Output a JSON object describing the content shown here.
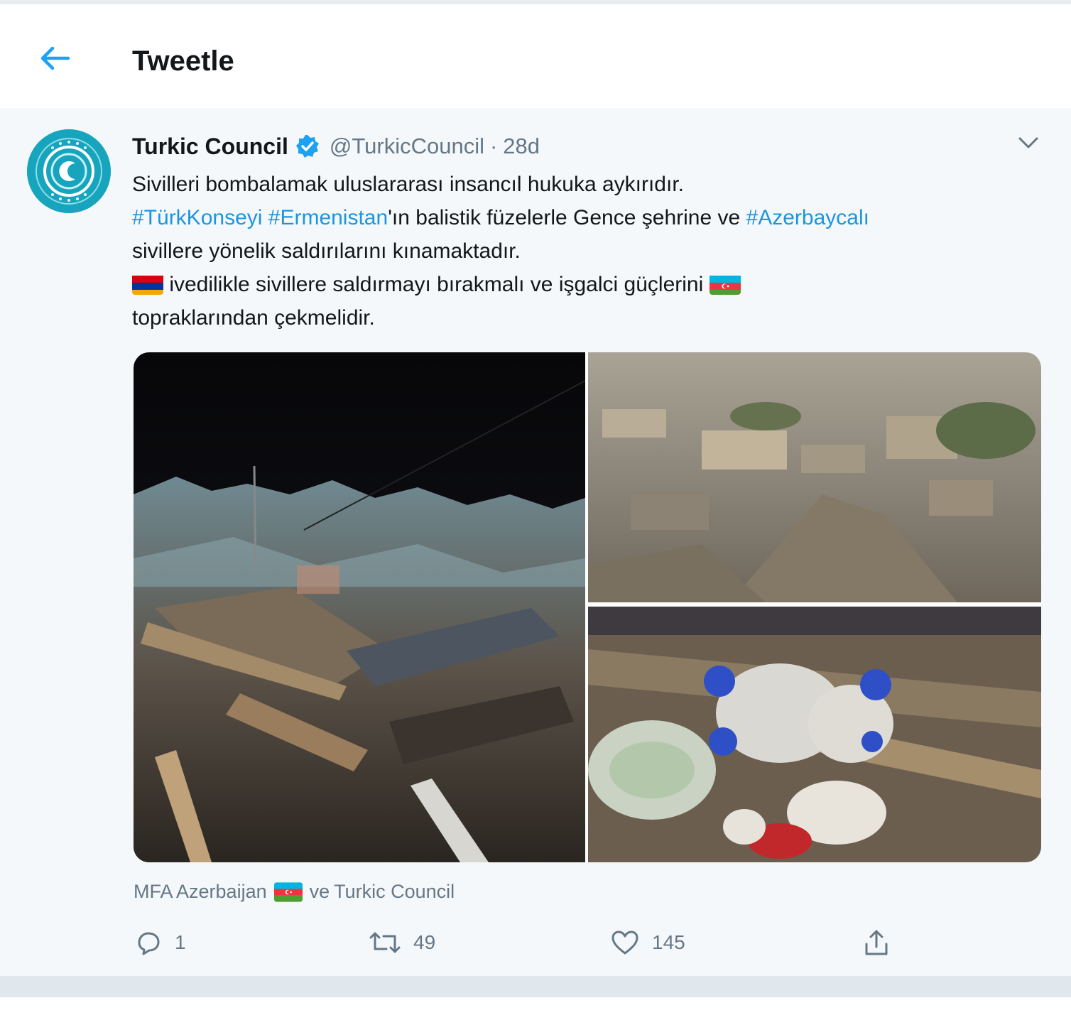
{
  "header": {
    "title": "Tweetle"
  },
  "tweet": {
    "author_name": "Turkic Council",
    "verified": true,
    "handle": "@TurkicCouncil",
    "separator": "·",
    "time": "28d",
    "lines": {
      "l1": "Sivilleri bombalamak uluslararası insancıl hukuka aykırıdır.",
      "h1": "#TürkKonseyi",
      "h2": "#Ermenistan",
      "l2_mid": "'ın balistik füzelerle Gence şehrine ve ",
      "h3": "#Azerbaycalı",
      "l3": "sivillere yönelik saldırılarını kınamaktadır.",
      "l4": " ivedilikle sivillere saldırmayı bırakmalı ve işgalci güçlerini ",
      "l5": "topraklarından çekmelidir."
    },
    "flags": [
      "armenia-flag",
      "azerbaijan-flag"
    ],
    "media": [
      "rubble-night-photo",
      "aerial-destroyed-city-photo",
      "teddy-bear-debris-photo"
    ],
    "tagged": {
      "first": "MFA Azerbaijan",
      "joiner": "ve",
      "second": "Turkic Council"
    },
    "actions": {
      "reply_count": "1",
      "retweet_count": "49",
      "like_count": "145"
    }
  },
  "colors": {
    "accent": "#1b95e0",
    "muted": "#657786",
    "text": "#14171a",
    "background": "#f5f8fa"
  }
}
